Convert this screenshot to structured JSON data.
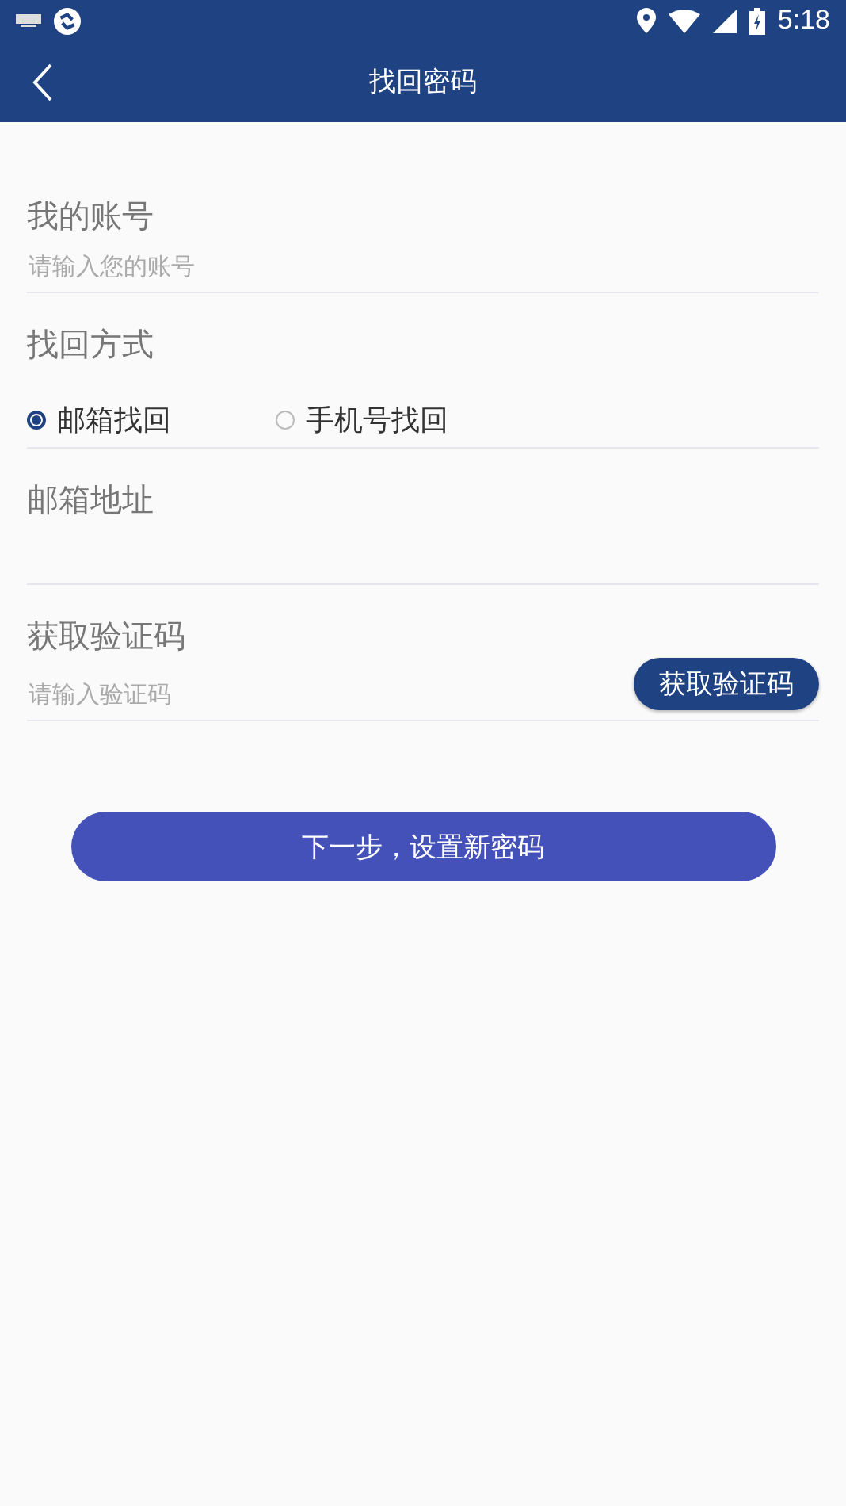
{
  "status_bar": {
    "time": "5:18"
  },
  "header": {
    "title": "找回密码"
  },
  "account": {
    "label": "我的账号",
    "placeholder": "请输入您的账号"
  },
  "method": {
    "label": "找回方式",
    "options": [
      {
        "label": "邮箱找回",
        "selected": true
      },
      {
        "label": "手机号找回",
        "selected": false
      }
    ]
  },
  "email": {
    "label": "邮箱地址"
  },
  "code": {
    "label": "获取验证码",
    "placeholder": "请输入验证码",
    "button": "获取验证码"
  },
  "next_button": "下一步，设置新密码"
}
